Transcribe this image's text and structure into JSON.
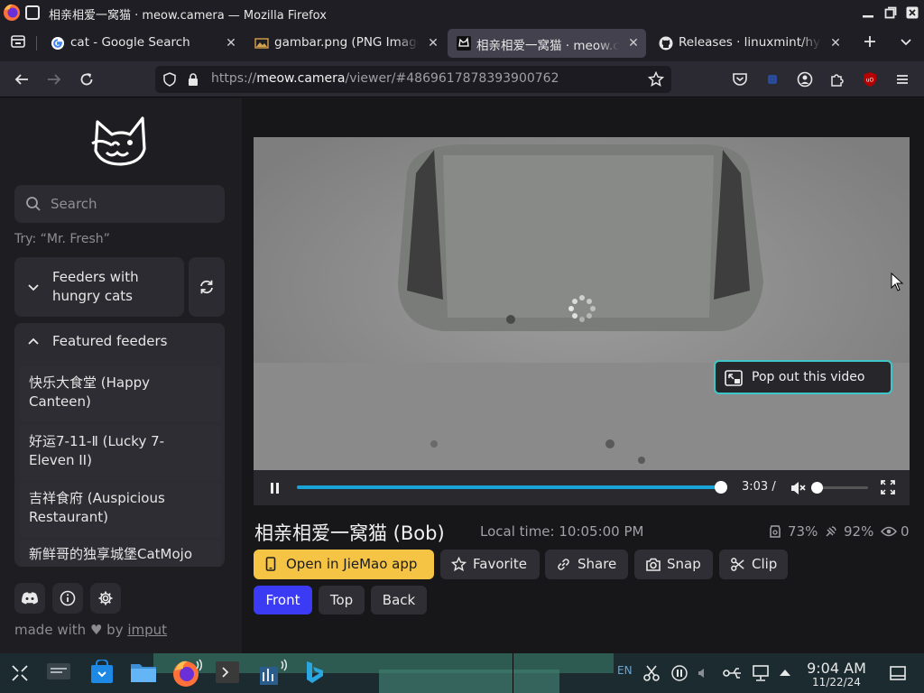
{
  "window": {
    "title": "相亲相爱一窝猫 · meow.camera — Mozilla Firefox"
  },
  "tabs": [
    {
      "label": "cat - Google Search",
      "icon": "google-icon"
    },
    {
      "label": "gambar.png (PNG Image, 1",
      "icon": "image-file-icon"
    },
    {
      "label": "相亲相爱一窝猫 · meow.camera",
      "icon": "meow-camera-icon",
      "active": true
    },
    {
      "label": "Releases · linuxmint/hypnotix",
      "icon": "github-icon"
    }
  ],
  "nav": {
    "url_prefix": "https://",
    "url_host": "meow.camera",
    "url_path": "/viewer/#4869617878393900762"
  },
  "sidebar": {
    "search_placeholder": "Search",
    "hint": "Try: “Mr. Fresh”",
    "hungry_label_1": "Feeders with",
    "hungry_label_2": "hungry cats",
    "featured_label": "Featured feeders",
    "feeders": [
      {
        "line1": "快乐大食堂 (Happy",
        "line2": "Canteen)"
      },
      {
        "line1": "好运7-11-Ⅱ (Lucky 7-",
        "line2": "Eleven II)"
      },
      {
        "line1": "吉祥食府 (Auspicious",
        "line2": "Restaurant)"
      },
      {
        "line1": "新鲜哥的独享城堡CatMojo",
        "line2": ""
      }
    ],
    "made_with": "made with",
    "made_by": "by",
    "made_author": "imput"
  },
  "player": {
    "time": "3:03 /",
    "popout_label": "Pop out this video",
    "progress": 1.0,
    "volume": 0.0
  },
  "feeder": {
    "title": "相亲相爱一窝猫 (Bob)",
    "local_time": "Local time: 10:05:00 PM",
    "food": "73%",
    "signal": "92%",
    "viewers": "0"
  },
  "actions": {
    "open_app": "Open in JieMao app",
    "favorite": "Favorite",
    "share": "Share",
    "snap": "Snap",
    "clip": "Clip"
  },
  "cameras": {
    "front": "Front",
    "top": "Top",
    "back": "Back"
  },
  "taskbar": {
    "lang": "EN",
    "time": "9:04 AM",
    "date": "11/22/24"
  },
  "colors": {
    "accent_yellow": "#f6c445",
    "accent_blue": "#3b3bf5",
    "progress_cyan": "#1aa3d6",
    "popout_border": "#3fc6c9"
  }
}
